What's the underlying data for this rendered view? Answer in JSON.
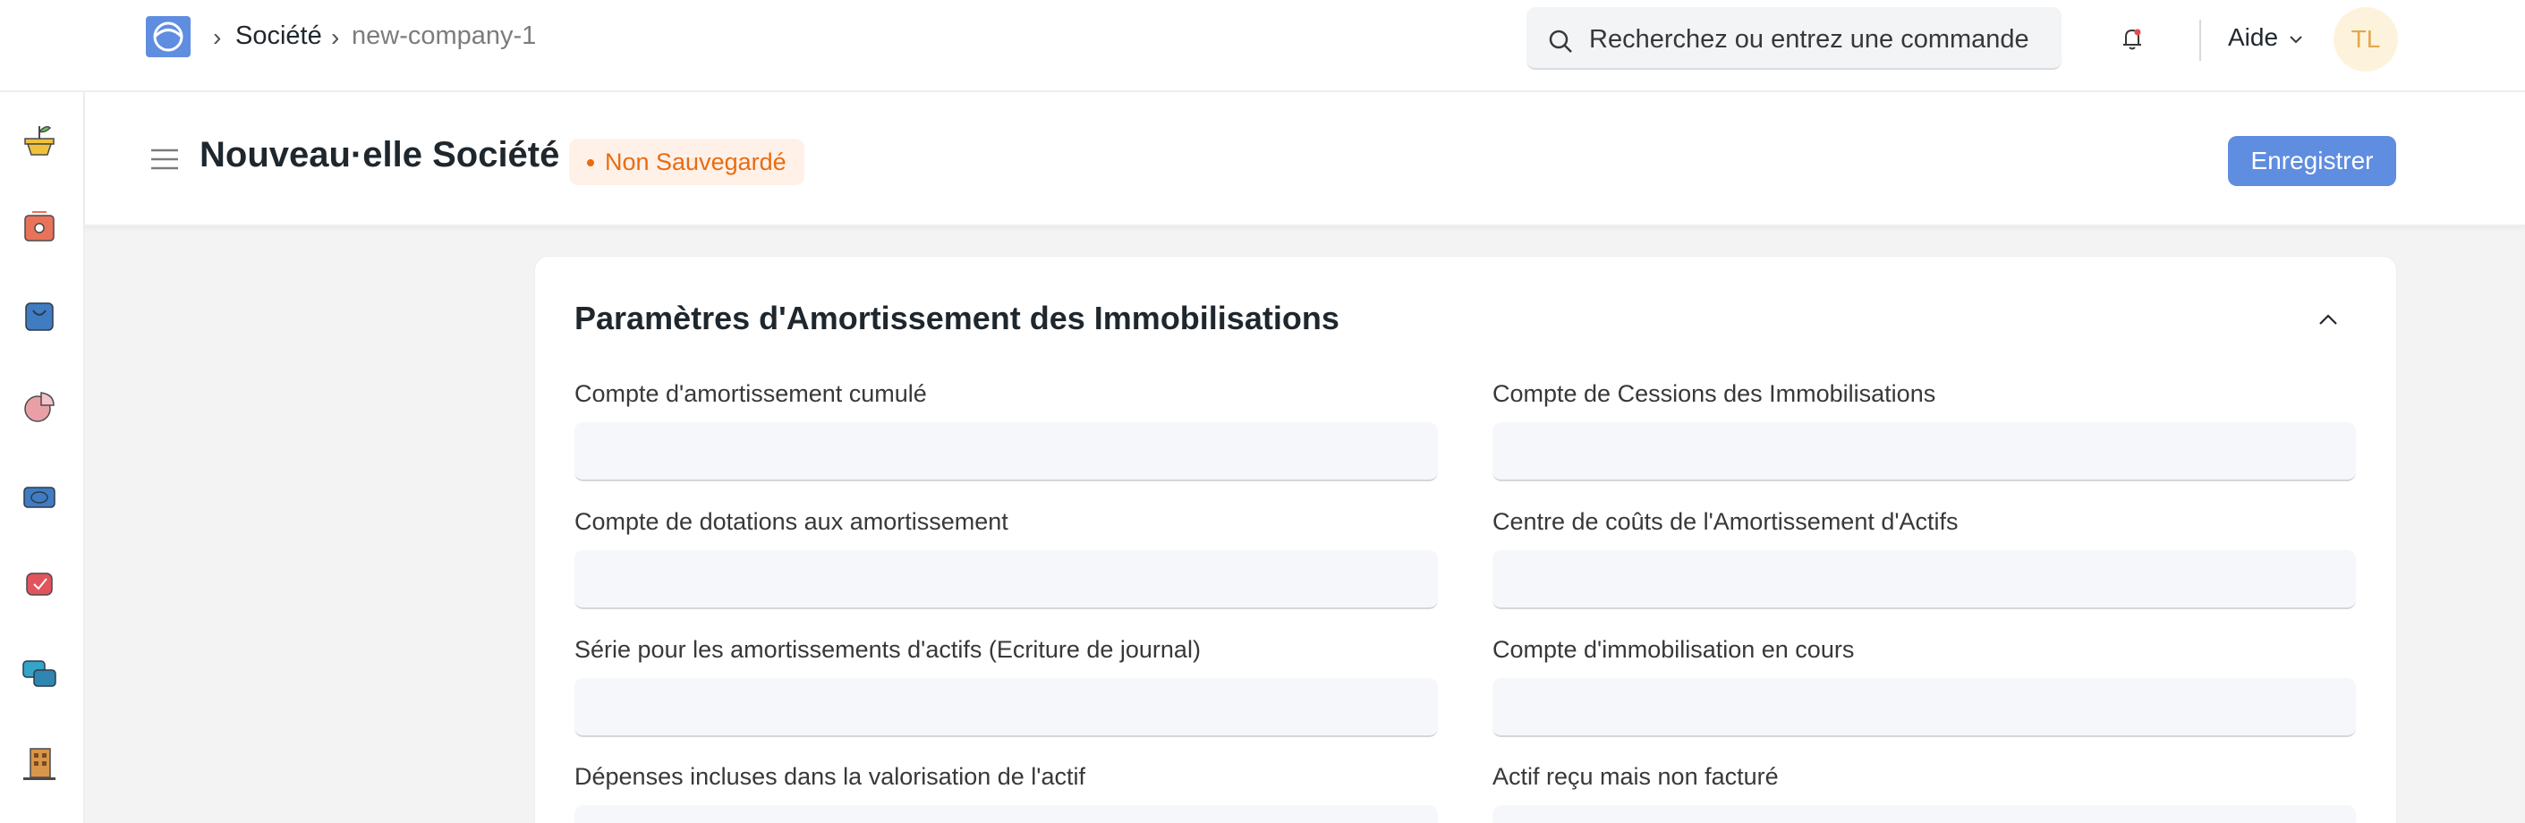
{
  "navbar": {
    "breadcrumbs": [
      "Société",
      "new-company-1"
    ],
    "search_placeholder": "Recherchez ou entrez une commande",
    "help_label": "Aide",
    "avatar_initials": "TL"
  },
  "sidebar": {
    "icons": [
      "plant-icon",
      "safe-icon",
      "shopping-bag-icon",
      "pie-chart-icon",
      "money-icon",
      "support-icon",
      "chat-icon",
      "building-icon"
    ]
  },
  "page": {
    "title": "Nouveau·elle Société",
    "status_badge": "Non Sauvegardé",
    "save_label": "Enregistrer"
  },
  "section": {
    "title": "Paramètres d'Amortissement des Immobilisations",
    "fields": [
      {
        "label": "Compte d'amortissement cumulé",
        "value": ""
      },
      {
        "label": "Compte de Cessions des Immobilisations",
        "value": ""
      },
      {
        "label": "Compte de dotations aux amortissement",
        "value": ""
      },
      {
        "label": "Centre de coûts de l'Amortissement d'Actifs",
        "value": ""
      },
      {
        "label": "Série pour les amortissements d'actifs (Ecriture de journal)",
        "value": ""
      },
      {
        "label": "Compte d'immobilisation en cours",
        "value": ""
      },
      {
        "label": "Dépenses incluses dans la valorisation de l'actif",
        "value": ""
      },
      {
        "label": "Actif reçu mais non facturé",
        "value": ""
      }
    ]
  },
  "colors": {
    "primary": "#5f8de0",
    "warning_bg": "#fff1e7",
    "warning_text": "#e86c13",
    "avatar_bg": "#fdf3dd",
    "avatar_text": "#e2a84b"
  }
}
